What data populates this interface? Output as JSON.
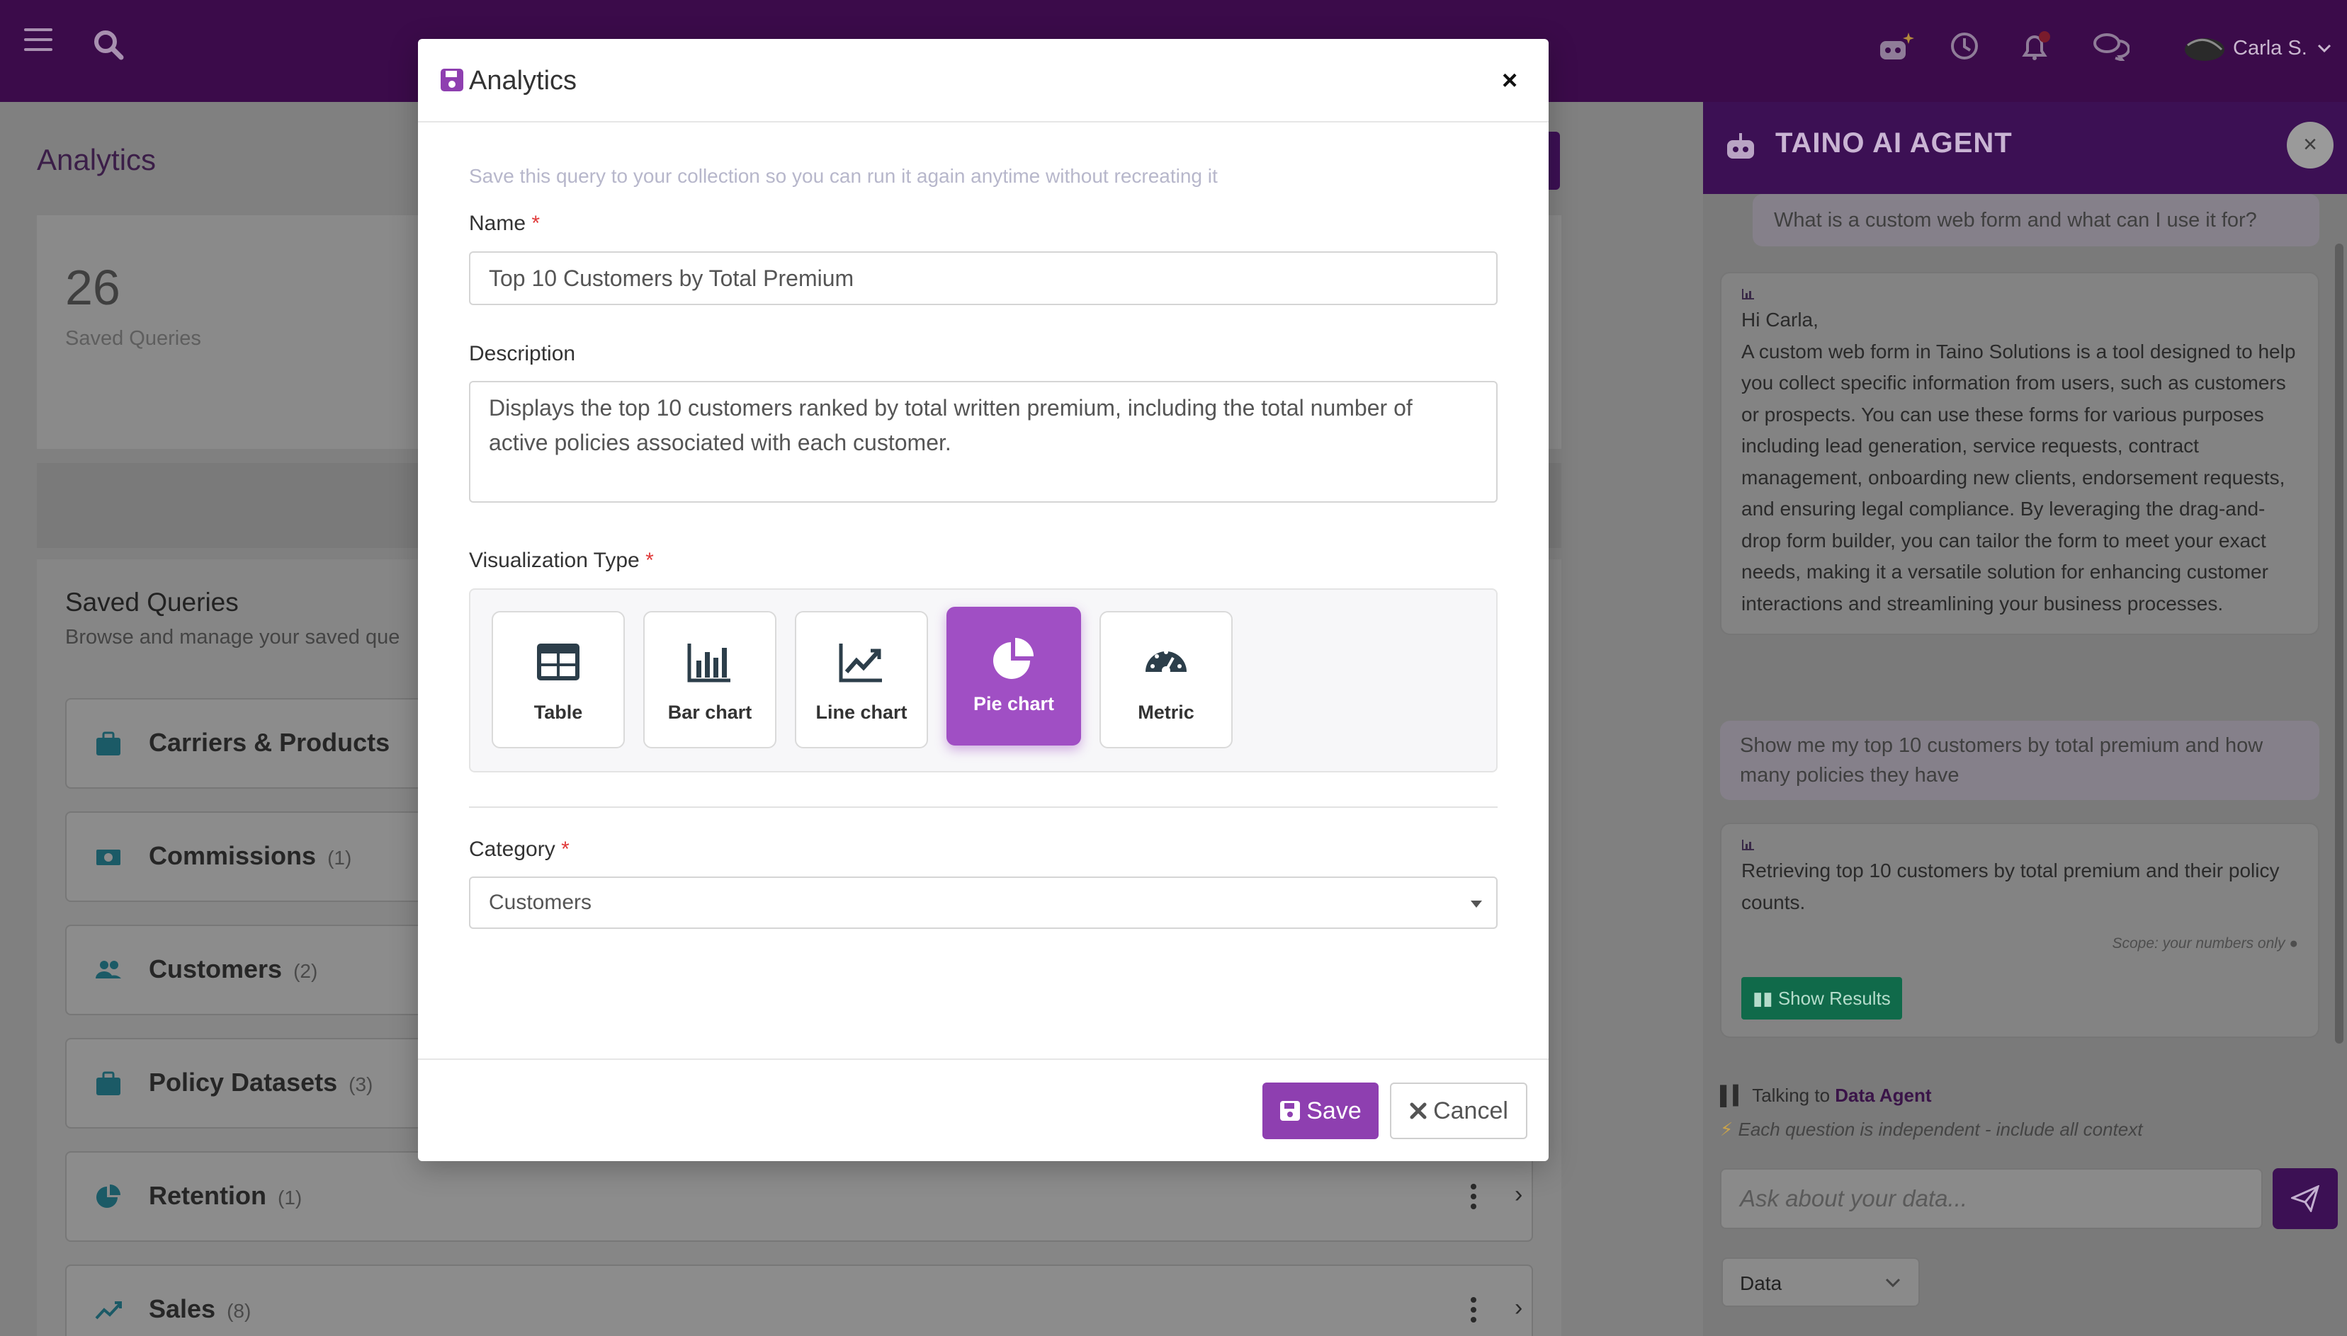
{
  "topbar": {
    "user_name": "Carla S."
  },
  "page": {
    "title": "Analytics",
    "stat_value": "26",
    "stat_label": "Saved Queries",
    "queries_title": "Saved Queries",
    "queries_subtitle": "Browse and manage your saved que",
    "rows": [
      {
        "name": "Carriers & Products",
        "count": "",
        "icon": "briefcase-icon"
      },
      {
        "name": "Commissions",
        "count": "(1)",
        "icon": "money-bill-icon"
      },
      {
        "name": "Customers",
        "count": "(2)",
        "icon": "users-icon"
      },
      {
        "name": "Policy Datasets",
        "count": "(3)",
        "icon": "briefcase-icon"
      },
      {
        "name": "Retention",
        "count": "(1)",
        "icon": "chart-pie-icon"
      },
      {
        "name": "Sales",
        "count": "(8)",
        "icon": "chart-line-icon"
      }
    ]
  },
  "ai_panel": {
    "title": "TAINO AI AGENT",
    "close_label": "×",
    "user_msg_1": "What is a custom web form and what can I use it for?",
    "ai_greeting": "Hi Carla,",
    "ai_msg_1": "A custom web form in Taino Solutions is a tool designed to help you collect specific information from users, such as customers or prospects. You can use these forms for various purposes including lead generation, service requests, contract management, onboarding new clients, endorsement requests, and ensuring legal compliance. By leveraging the drag-and-drop form builder, you can tailor the form to meet your exact needs, making it a versatile solution for enhancing customer interactions and streamlining your business processes.",
    "user_msg_2": "Show me my top 10 customers by total premium and how many policies they have",
    "ai_msg_2": "Retrieving top 10 customers by total premium and their policy counts.",
    "scope_note": "Scope: your numbers only",
    "show_results_label": "Show Results",
    "talking_prefix": "Talking to",
    "agent_name": "Data Agent",
    "independent_note": "Each question is independent - include all context",
    "input_placeholder": "Ask about your data...",
    "agent_select_value": "Data"
  },
  "modal": {
    "title": "Analytics",
    "close_label": "×",
    "hint": "Save this query to your collection so you can run it again anytime without recreating it",
    "name_label": "Name",
    "name_value": "Top 10 Customers by Total Premium",
    "description_label": "Description",
    "description_value": "Displays the top 10 customers ranked by total written premium, including the total number of active policies associated with each customer.",
    "viz_label": "Visualization Type",
    "viz_options": [
      {
        "label": "Table",
        "icon": "table-icon",
        "selected": false
      },
      {
        "label": "Bar chart",
        "icon": "bar-chart-icon",
        "selected": false
      },
      {
        "label": "Line chart",
        "icon": "line-chart-icon",
        "selected": false
      },
      {
        "label": "Pie chart",
        "icon": "pie-chart-icon",
        "selected": true
      },
      {
        "label": "Metric",
        "icon": "gauge-icon",
        "selected": false
      }
    ],
    "category_label": "Category",
    "category_value": "Customers",
    "required_mark": "*",
    "save_label": "Save",
    "cancel_label": "Cancel"
  },
  "colors": {
    "brand_purple": "#3c1054",
    "accent_purple": "#a04fc4",
    "save_button": "#8e3fb0",
    "show_results_green": "#106a4a",
    "required_red": "#e03a3a"
  }
}
